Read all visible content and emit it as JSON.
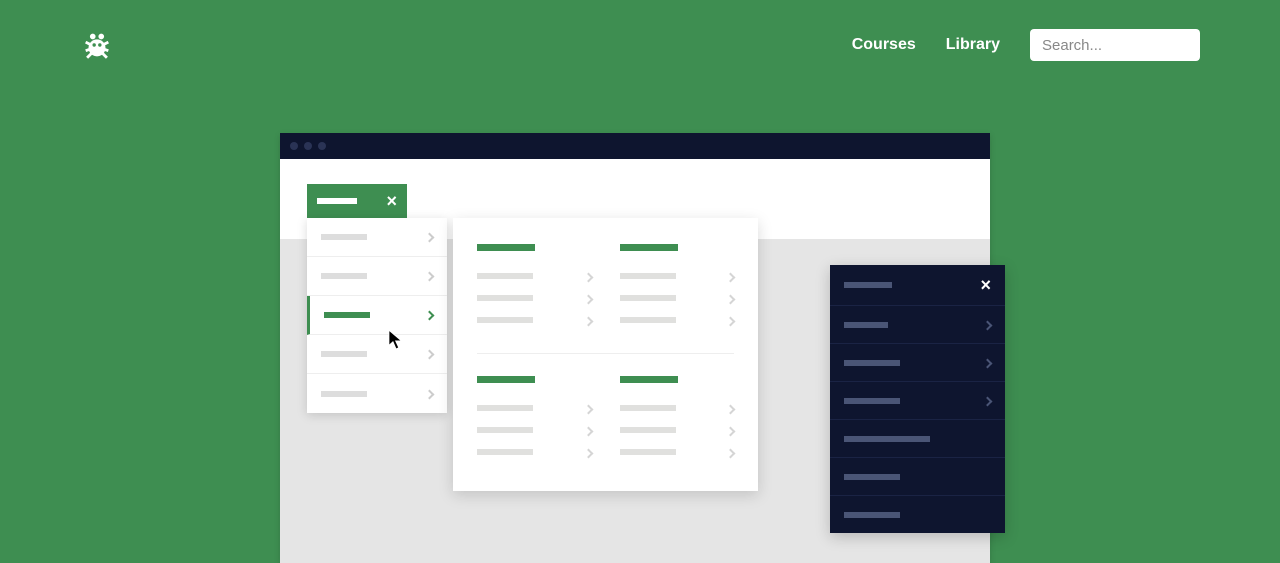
{
  "nav": {
    "links": [
      "Courses",
      "Library"
    ],
    "search_placeholder": "Search..."
  },
  "colors": {
    "brand": "#3e8e51",
    "dark": "#0e152f"
  },
  "stage": {
    "window_dots": 3
  },
  "green_tab": {
    "close_label": "×"
  },
  "light_menu": {
    "items": [
      {
        "active": false,
        "has_chevron": true
      },
      {
        "active": false,
        "has_chevron": true
      },
      {
        "active": true,
        "has_chevron": true
      },
      {
        "active": false,
        "has_chevron": true
      },
      {
        "active": false,
        "has_chevron": true
      }
    ]
  },
  "mega": {
    "sections": [
      {
        "columns": [
          {
            "lines": 3
          },
          {
            "lines": 3
          }
        ]
      },
      {
        "columns": [
          {
            "lines": 3
          },
          {
            "lines": 3
          }
        ]
      }
    ]
  },
  "dark_panel": {
    "close_label": "×",
    "items": [
      {
        "width": "w1",
        "chevron": true
      },
      {
        "width": "w2",
        "chevron": true
      },
      {
        "width": "w2",
        "chevron": true
      },
      {
        "width": "w3",
        "chevron": false
      },
      {
        "width": "w2",
        "chevron": false
      },
      {
        "width": "w2",
        "chevron": false
      }
    ]
  }
}
